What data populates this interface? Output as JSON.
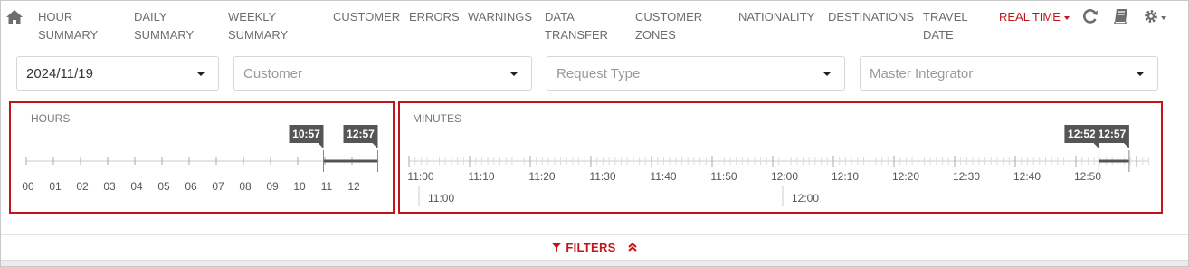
{
  "nav": {
    "items": [
      {
        "label": "HOUR\nSUMMARY"
      },
      {
        "label": "DAILY\nSUMMARY"
      },
      {
        "label": "WEEKLY\nSUMMARY"
      },
      {
        "label": "CUSTOMER"
      },
      {
        "label": "ERRORS"
      },
      {
        "label": "WARNINGS"
      },
      {
        "label": "DATA\nTRANSFER"
      },
      {
        "label": "CUSTOMER\nZONES"
      },
      {
        "label": "NATIONALITY"
      },
      {
        "label": "DESTINATIONS"
      },
      {
        "label": "TRAVEL\nDATE"
      }
    ],
    "realtime": "REAL TIME",
    "icons": [
      "home-icon",
      "refresh-icon",
      "book-icon",
      "gear-icon"
    ],
    "accent_color": "#c0161b"
  },
  "filters_row": {
    "date": "2024/11/19",
    "customer_placeholder": "Customer",
    "request_type_placeholder": "Request Type",
    "master_integrator_placeholder": "Master Integrator"
  },
  "hours_panel": {
    "title": "HOURS",
    "tick_labels": [
      "00",
      "01",
      "02",
      "03",
      "04",
      "05",
      "06",
      "07",
      "08",
      "09",
      "10",
      "11",
      "12"
    ],
    "range_start": "10:57",
    "range_end": "12:57"
  },
  "minutes_panel": {
    "title": "MINUTES",
    "tick_labels": [
      "11:00",
      "11:10",
      "11:20",
      "11:30",
      "11:40",
      "11:50",
      "12:00",
      "12:10",
      "12:20",
      "12:30",
      "12:40",
      "12:50"
    ],
    "hour_markers": [
      "11:00",
      "12:00"
    ],
    "range_start": "12:52",
    "range_end": "12:57"
  },
  "filters_toggle": {
    "label": "FILTERS"
  }
}
